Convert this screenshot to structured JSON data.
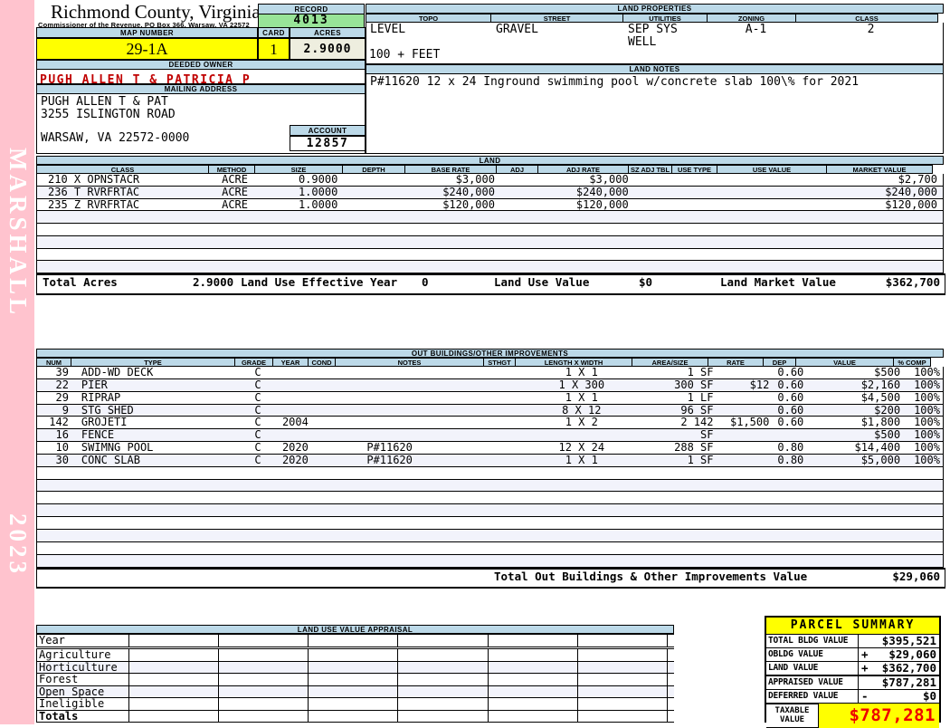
{
  "sidebar": {
    "vendor": "MARSHALL",
    "year": "2023"
  },
  "header": {
    "county": "Richmond County, Virginia",
    "commissioner": "Commissioner of the Revenue, PO Box 366, Warsaw, VA 22572",
    "record_label": "RECORD",
    "record": "4013",
    "map_number_label": "MAP NUMBER",
    "map_number": "29-1A",
    "card_label": "CARD",
    "card": "1",
    "acres_label": "ACRES",
    "acres": "2.9000",
    "deeded_owner_label": "DEEDED OWNER",
    "deeded_owner": "PUGH ALLEN T & PATRICIA P",
    "mailing_address_label": "MAILING ADDRESS",
    "address_line1": "PUGH ALLEN T & PAT",
    "address_line2": "3255 ISLINGTON ROAD",
    "address_line3": "WARSAW, VA 22572-0000",
    "account_label": "ACCOUNT",
    "account": "12857"
  },
  "land_properties": {
    "title": "LAND PROPERTIES",
    "columns": [
      "TOPO",
      "STREET",
      "UTILITIES",
      "ZONING",
      "CLASS"
    ],
    "topo": "LEVEL",
    "street": "GRAVEL",
    "utilities_line1": "SEP SYS",
    "utilities_line2": "WELL",
    "zoning": "A-1",
    "class": "2",
    "frontage": "100 + FEET"
  },
  "land_notes": {
    "title": "LAND NOTES",
    "text": "P#11620 12 x 24 Inground swimming pool w/concrete slab 100\\% for 2021"
  },
  "land": {
    "title": "LAND",
    "columns": [
      "CLASS",
      "METHOD",
      "SIZE",
      "DEPTH",
      "BASE RATE",
      "ADJ",
      "ADJ RATE",
      "SZ ADJ TBL",
      "USE TYPE",
      "USE VALUE",
      "MARKET VALUE"
    ],
    "rows": [
      {
        "class": "210 X OPNSTACR",
        "method": "ACRE",
        "size": "0.9000",
        "depth": "",
        "base_rate": "$3,000",
        "adj": "",
        "adj_rate": "$3,000",
        "sz_adj_tbl": "",
        "use_type": "",
        "use_value": "",
        "market_value": "$2,700"
      },
      {
        "class": "236 T RVRFRTAC",
        "method": "ACRE",
        "size": "1.0000",
        "depth": "",
        "base_rate": "$240,000",
        "adj": "",
        "adj_rate": "$240,000",
        "sz_adj_tbl": "",
        "use_type": "",
        "use_value": "",
        "market_value": "$240,000"
      },
      {
        "class": "235 Z RVRFRTAC",
        "method": "ACRE",
        "size": "1.0000",
        "depth": "",
        "base_rate": "$120,000",
        "adj": "",
        "adj_rate": "$120,000",
        "sz_adj_tbl": "",
        "use_type": "",
        "use_value": "",
        "market_value": "$120,000"
      }
    ],
    "totals": {
      "total_acres_label": "Total Acres",
      "total_acres": "2.9000",
      "effective_year_label": "Land Use Effective Year",
      "effective_year": "0",
      "use_value_label": "Land Use Value",
      "use_value": "$0",
      "market_value_label": "Land Market Value",
      "market_value": "$362,700"
    }
  },
  "out_buildings": {
    "title": "OUT BUILDINGS/OTHER IMPROVEMENTS",
    "columns": [
      "NUM",
      "TYPE",
      "GRADE",
      "YEAR",
      "COND",
      "NOTES",
      "STHGT",
      "LENGTH X WIDTH",
      "AREA/SIZE",
      "RATE",
      "DEP",
      "VALUE",
      "% COMP"
    ],
    "rows": [
      {
        "num": "39",
        "type": "ADD-WD DECK",
        "grade": "C",
        "year": "",
        "cond": "",
        "notes": "",
        "sthgt": "",
        "lxw": "1 X 1",
        "area": "1 SF",
        "rate": "",
        "dep": "0.60",
        "value": "$500",
        "comp": "100%"
      },
      {
        "num": "22",
        "type": "PIER",
        "grade": "C",
        "year": "",
        "cond": "",
        "notes": "",
        "sthgt": "",
        "lxw": "1 X 300",
        "area": "300 SF",
        "rate": "$12",
        "dep": "0.60",
        "value": "$2,160",
        "comp": "100%"
      },
      {
        "num": "29",
        "type": "RIPRAP",
        "grade": "C",
        "year": "",
        "cond": "",
        "notes": "",
        "sthgt": "",
        "lxw": "1 X 1",
        "area": "1 LF",
        "rate": "",
        "dep": "0.60",
        "value": "$4,500",
        "comp": "100%"
      },
      {
        "num": "9",
        "type": "STG SHED",
        "grade": "C",
        "year": "",
        "cond": "",
        "notes": "",
        "sthgt": "",
        "lxw": "8 X 12",
        "area": "96 SF",
        "rate": "",
        "dep": "0.60",
        "value": "$200",
        "comp": "100%"
      },
      {
        "num": "142",
        "type": "GROJETI",
        "grade": "C",
        "year": "2004",
        "cond": "",
        "notes": "",
        "sthgt": "",
        "lxw": "1 X 2",
        "area": "2 142",
        "rate": "$1,500",
        "dep": "0.60",
        "value": "$1,800",
        "comp": "100%"
      },
      {
        "num": "16",
        "type": "FENCE",
        "grade": "C",
        "year": "",
        "cond": "",
        "notes": "",
        "sthgt": "",
        "lxw": "",
        "area": "SF",
        "rate": "",
        "dep": "",
        "value": "$500",
        "comp": "100%"
      },
      {
        "num": "10",
        "type": "SWIMNG POOL",
        "grade": "C",
        "year": "2020",
        "cond": "",
        "notes": "P#11620",
        "sthgt": "",
        "lxw": "12 X 24",
        "area": "288 SF",
        "rate": "",
        "dep": "0.80",
        "value": "$14,400",
        "comp": "100%"
      },
      {
        "num": "30",
        "type": "CONC SLAB",
        "grade": "C",
        "year": "2020",
        "cond": "",
        "notes": "P#11620",
        "sthgt": "",
        "lxw": "1 X 1",
        "area": "1 SF",
        "rate": "",
        "dep": "0.80",
        "value": "$5,000",
        "comp": "100%"
      }
    ],
    "total_label": "Total Out Buildings & Other Improvements Value",
    "total_value": "$29,060"
  },
  "land_use_appraisal": {
    "title": "LAND USE VALUE APPRAISAL",
    "row_labels": [
      "Year",
      "Agriculture",
      "Horticulture",
      "Forest",
      "Open Space",
      "Ineligible",
      "Totals"
    ]
  },
  "parcel_summary": {
    "title": "PARCEL SUMMARY",
    "rows": [
      {
        "label": "TOTAL BLDG VALUE",
        "op": "",
        "value": "$395,521"
      },
      {
        "label": "OBLDG VALUE",
        "op": "+",
        "value": "$29,060"
      },
      {
        "label": "LAND VALUE",
        "op": "+",
        "value": "$362,700"
      },
      {
        "label": "APPRAISED VALUE",
        "op": "",
        "value": "$787,281"
      },
      {
        "label": "DEFERRED VALUE",
        "op": "-",
        "value": "$0"
      }
    ],
    "taxable_label": "TAXABLE VALUE",
    "taxable_value": "$787,281"
  },
  "colors": {
    "header_blue": "#BCD9E8",
    "highlight_yellow": "#FFFF00",
    "record_green": "#98E498",
    "acres_beige": "#EEEEDF",
    "spine_pink": "#FFC3CE",
    "owner_red": "#C00000",
    "taxable_red": "#EE0000"
  }
}
